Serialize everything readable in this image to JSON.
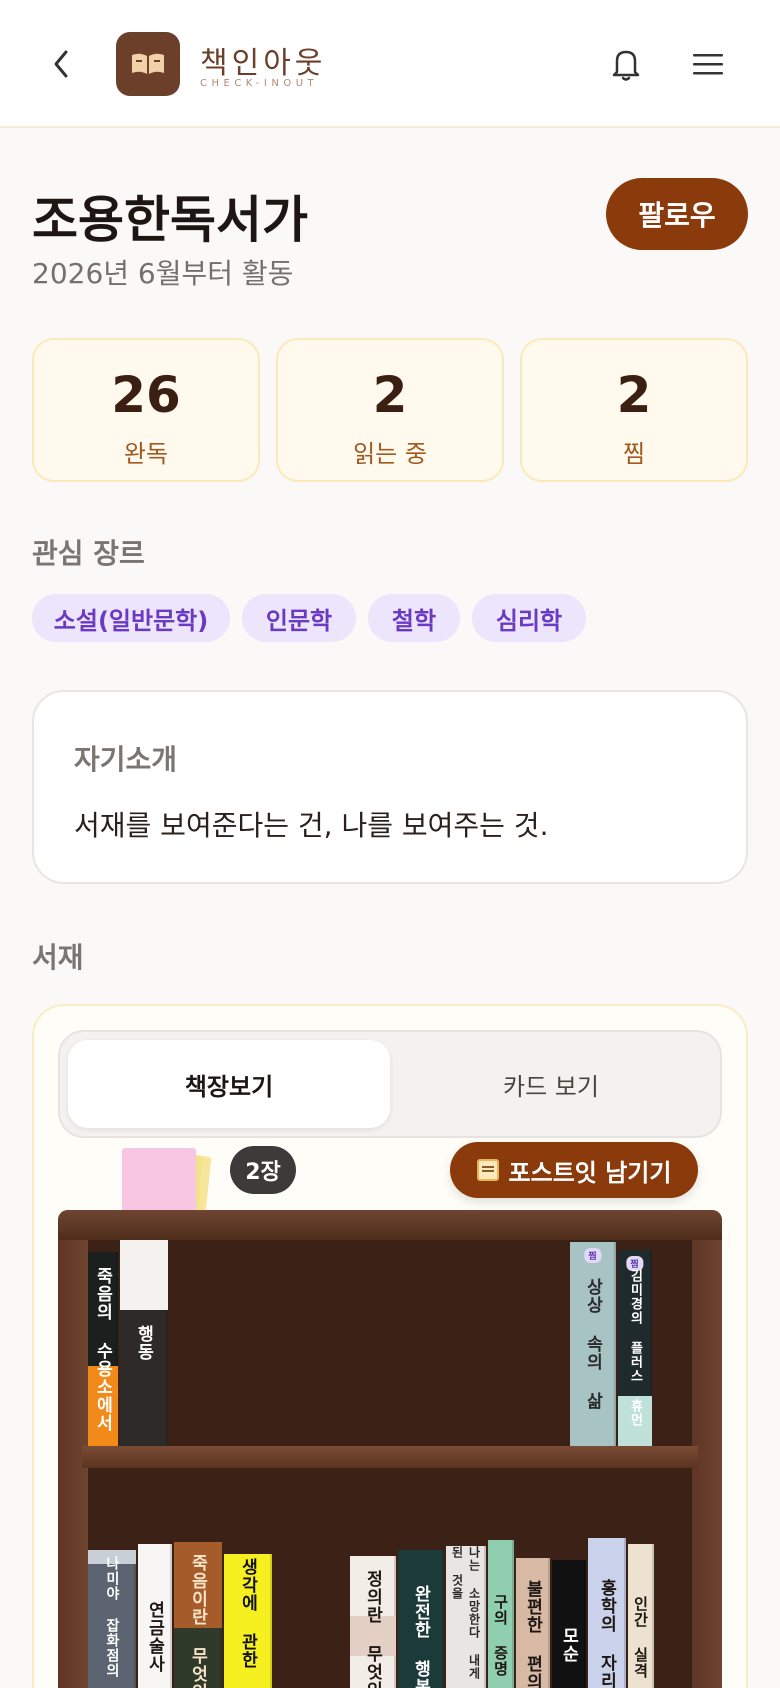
{
  "header": {
    "logo_title": "책인아웃",
    "logo_subtitle": "CHECK-INOUT",
    "back_icon": "chevron-left-icon",
    "bell_icon": "bell-icon",
    "menu_icon": "hamburger-menu-icon"
  },
  "profile": {
    "name": "조용한독서가",
    "since": "2026년 6월부터 활동",
    "follow_label": "팔로우"
  },
  "stats": [
    {
      "value": "26",
      "label": "완독"
    },
    {
      "value": "2",
      "label": "읽는 중"
    },
    {
      "value": "2",
      "label": "찜"
    }
  ],
  "genres": {
    "title": "관심 장르",
    "items": [
      "소설(일반문학)",
      "인문학",
      "철학",
      "심리학"
    ]
  },
  "intro": {
    "title": "자기소개",
    "text": "서재를 보여준다는 건, 나를 보여주는 것."
  },
  "library": {
    "title": "서재",
    "tab_shelf": "책장보기",
    "tab_card": "카드 보기",
    "postit_count": "2장",
    "postit_button": "포스트잇 남기기"
  },
  "shelf_row1": [
    {
      "title": "죽음의 수용소에서",
      "bg": "#1b1f1d",
      "fg": "#ffffff",
      "accent": "#f28a1a"
    },
    {
      "title": "행동",
      "bg": "#2e2a28",
      "fg": "#ffffff",
      "accent": "#f4f2ef"
    },
    {
      "title": "상상 속의 삶",
      "bg": "#a7c3c4",
      "fg": "#2a2a2a",
      "tag": "찜"
    },
    {
      "title": "김미경의 플러스 휴먼",
      "bg": "#1e2a2c",
      "fg": "#ffffff",
      "tag": "찜",
      "accent": "#bfe1d9"
    }
  ],
  "shelf_row2": [
    {
      "title": "나미야 잡화점의 기적",
      "bg": "#5b6470",
      "fg": "#ffffff"
    },
    {
      "title": "연금술사",
      "bg": "#f7f6f4",
      "fg": "#1e1612"
    },
    {
      "title": "죽음이란 무엇인가",
      "bg": "#2f3a2a",
      "fg": "#f7e4c8",
      "accent": "#a65b2a"
    },
    {
      "title": "생각에 관한 생각",
      "bg": "#f7f020",
      "fg": "#111111"
    },
    {
      "title": "정의란 무엇인가",
      "bg": "#f3ede7",
      "fg": "#1e1612"
    },
    {
      "title": "완전한 행복",
      "bg": "#1d3a3a",
      "fg": "#ffffff"
    },
    {
      "title": "나는 소망한다 내게 금지된 것을",
      "bg": "#e8e6e2",
      "fg": "#2a2a2a"
    },
    {
      "title": "구의 증명",
      "bg": "#8fcfb0",
      "fg": "#1e1612"
    },
    {
      "title": "불편한 편의점",
      "bg": "#d7b9a6",
      "fg": "#1e1612"
    },
    {
      "title": "모순",
      "bg": "#111111",
      "fg": "#ffffff"
    },
    {
      "title": "홍학의 자리",
      "bg": "#c9d2ea",
      "fg": "#1e1612"
    },
    {
      "title": "인간 실격",
      "bg": "#ece2cf",
      "fg": "#1e1612"
    }
  ]
}
